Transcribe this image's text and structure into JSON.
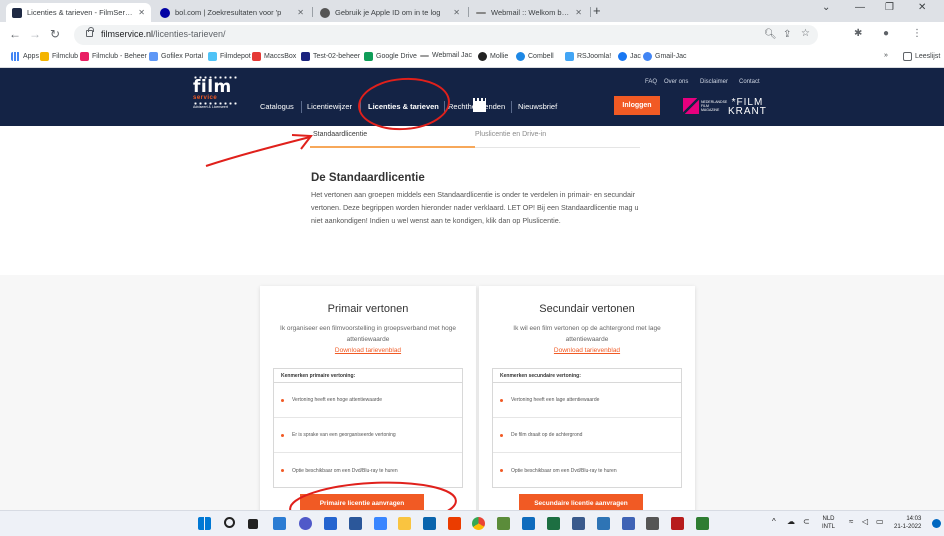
{
  "browser": {
    "tabs": [
      {
        "title": "Licenties & tarieven - FilmService",
        "active": true,
        "favicon_color": "#1f2a44"
      },
      {
        "title": "bol.com | Zoekresultaten voor 'p",
        "active": false,
        "favicon_color": "#0000a4"
      },
      {
        "title": "Gebruik je Apple ID om in te log",
        "active": false,
        "favicon_color": "#555555"
      },
      {
        "title": "Webmail :: Welkom bij Webmail",
        "active": false,
        "favicon_color": "#888888"
      }
    ],
    "new_tab": "+",
    "url_host": "filmservice.nl",
    "url_path": "/licenties-tarieven/",
    "bookmarks": [
      {
        "label": "Apps",
        "color": "#4285f4"
      },
      {
        "label": "Filmclub",
        "color": "#f4b400"
      },
      {
        "label": "Filmclub - Beheer",
        "color": "#e91e63"
      },
      {
        "label": "Gofilex Portal",
        "color": "#5e97f6"
      },
      {
        "label": "Filmdepot",
        "color": "#4fc3f7"
      },
      {
        "label": "MaccsBox",
        "color": "#e53935"
      },
      {
        "label": "Test-02-beheer",
        "color": "#1a237e"
      },
      {
        "label": "Google Drive",
        "color": "#0f9d58"
      },
      {
        "label": "Webmail Jac",
        "color": "#9e9e9e"
      },
      {
        "label": "Mollie",
        "color": "#222222"
      },
      {
        "label": "Combell",
        "color": "#1e88e5"
      },
      {
        "label": "RSJoomla!",
        "color": "#42a5f5"
      },
      {
        "label": "Jac",
        "color": "#1877f2"
      },
      {
        "label": "Gmail-Jac",
        "color": "#4285f4"
      }
    ],
    "reading_list": "Leeslijst"
  },
  "site": {
    "logo": {
      "film": "film",
      "service": "service",
      "sub": "Adviseert & Licenseert"
    },
    "top_links": [
      "FAQ",
      "Over ons",
      "Disclaimer",
      "Contact"
    ],
    "nav": [
      {
        "label": "Catalogus",
        "active": false
      },
      {
        "label": "Licentiewijzer",
        "active": false
      },
      {
        "label": "Licenties & tarieven",
        "active": true
      },
      {
        "label": "Rechthebbenden",
        "active": false
      },
      {
        "label": "Nieuwsbrief",
        "active": false
      }
    ],
    "login": "Inloggen",
    "partner_text": "NEDERLANDSE FILM MAGAZINE",
    "filmkrant_top": "*FILM",
    "filmkrant_bottom": "KRANT",
    "accent_color": "#f15a24",
    "header_color": "#142345"
  },
  "subtabs": {
    "active": "Standaardlicentie",
    "inactive": "Pluslicentie en Drive-in"
  },
  "intro": {
    "title": "De Standaardlicentie",
    "body": "Het vertonen aan groepen middels een Standaardlicentie is onder te verdelen in primair- en secundair vertonen. Deze begrippen worden hieronder nader verklaard. LET OP! Bij een Standaardlicentie mag u niet aankondigen! Indien u wel wenst aan te kondigen, klik dan op Pluslicentie."
  },
  "cards": [
    {
      "title": "Primair vertonen",
      "desc": "Ik organiseer een filmvoorstelling in groepsverband met hoge attentiewaarde",
      "download": "Download tarievenblad",
      "table_header": "Kenmerken primaire vertoning:",
      "rows": [
        "Vertoning heeft een hoge attentiewaarde",
        "Er is sprake van een georganiseerde vertoning",
        "Optie beschikbaar om een Dvd/Blu-ray te huren"
      ],
      "cta": "Primaire licentie aanvragen"
    },
    {
      "title": "Secundair vertonen",
      "desc": "Ik wil een film vertonen op de achtergrond met lage attentiewaarde",
      "download": "Download tarievenblad",
      "table_header": "Kenmerken secundaire vertoning:",
      "rows": [
        "Vertoning heeft een lage attentiewaarde",
        "De film draait op de achtergrond",
        "Optie beschikbaar om een Dvd/Blu-ray te huren"
      ],
      "cta": "Secundaire licentie aanvragen"
    }
  ],
  "taskbar": {
    "apps": [
      {
        "name": "start-icon",
        "color": "#0078d4"
      },
      {
        "name": "search-icon",
        "color": "#222222"
      },
      {
        "name": "task-view-icon",
        "color": "#222222"
      },
      {
        "name": "widgets-icon",
        "color": "#2b7cd3"
      },
      {
        "name": "chat-icon",
        "color": "#5059c9"
      },
      {
        "name": "todo-icon",
        "color": "#2564cf"
      },
      {
        "name": "word-icon",
        "color": "#2b579a"
      },
      {
        "name": "notepad-icon",
        "color": "#3a86ff"
      },
      {
        "name": "explorer-icon",
        "color": "#f9c440"
      },
      {
        "name": "mail-icon",
        "color": "#0a64ad"
      },
      {
        "name": "office-icon",
        "color": "#eb3c00"
      },
      {
        "name": "chrome-icon",
        "color": "#34a853"
      },
      {
        "name": "photos-icon",
        "color": "#5b8c3a"
      },
      {
        "name": "outlook-icon",
        "color": "#0f6cbd"
      },
      {
        "name": "excel-icon",
        "color": "#1d6f42"
      },
      {
        "name": "sway-icon",
        "color": "#3a5a8c"
      },
      {
        "name": "store-icon",
        "color": "#2e74b5"
      },
      {
        "name": "teams-icon",
        "color": "#3f63b5"
      },
      {
        "name": "calculator-icon",
        "color": "#555555"
      },
      {
        "name": "filezilla-icon",
        "color": "#b71c1c"
      },
      {
        "name": "tasks-icon",
        "color": "#2e7d32"
      }
    ],
    "lang_top": "NLD",
    "lang_bottom": "INTL",
    "time": "14:03",
    "date": "21-1-2022"
  }
}
